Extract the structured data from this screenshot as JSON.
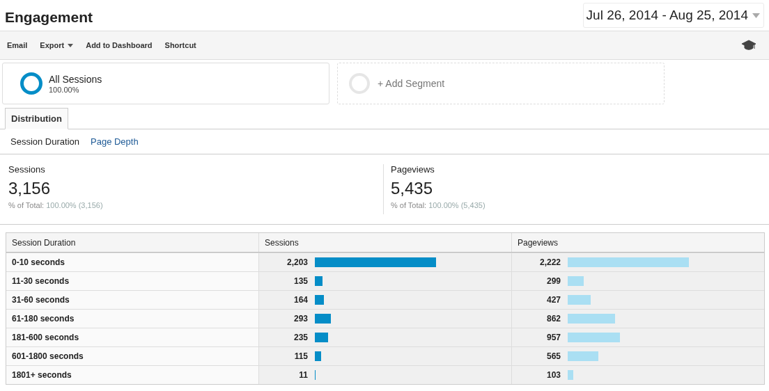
{
  "title": "Engagement",
  "date_range": "Jul 26, 2014 - Aug 25, 2014",
  "toolbar": [
    {
      "label": "Email",
      "has_menu": false
    },
    {
      "label": "Export",
      "has_menu": true
    },
    {
      "label": "Add to Dashboard",
      "has_menu": false
    },
    {
      "label": "Shortcut",
      "has_menu": false
    }
  ],
  "segments": [
    {
      "kind": "segment",
      "name": "All Sessions",
      "share": "100.00%"
    },
    {
      "kind": "add",
      "name": "+ Add Segment"
    }
  ],
  "tabs": [
    {
      "label": "Distribution",
      "selected": true
    }
  ],
  "subtabs": [
    {
      "label": "Session Duration",
      "selected": true
    },
    {
      "label": "Page Depth",
      "selected": false
    }
  ],
  "metrics": [
    {
      "label": "Sessions",
      "value": "3,156",
      "total_label": "% of Total:",
      "total": "100.00% (3,156)"
    },
    {
      "label": "Pageviews",
      "value": "5,435",
      "total_label": "% of Total:",
      "total": "100.00% (5,435)"
    }
  ],
  "table": {
    "columns": [
      "Session Duration",
      "Sessions",
      "Pageviews"
    ],
    "rows": [
      {
        "duration": "0-10 seconds",
        "sessions": "2,203",
        "pageviews": "2,222"
      },
      {
        "duration": "11-30 seconds",
        "sessions": "135",
        "pageviews": "299"
      },
      {
        "duration": "31-60 seconds",
        "sessions": "164",
        "pageviews": "427"
      },
      {
        "duration": "61-180 seconds",
        "sessions": "293",
        "pageviews": "862"
      },
      {
        "duration": "181-600 seconds",
        "sessions": "235",
        "pageviews": "957"
      },
      {
        "duration": "601-1800 seconds",
        "sessions": "115",
        "pageviews": "565"
      },
      {
        "duration": "1801+ seconds",
        "sessions": "11",
        "pageviews": "103"
      }
    ]
  }
}
